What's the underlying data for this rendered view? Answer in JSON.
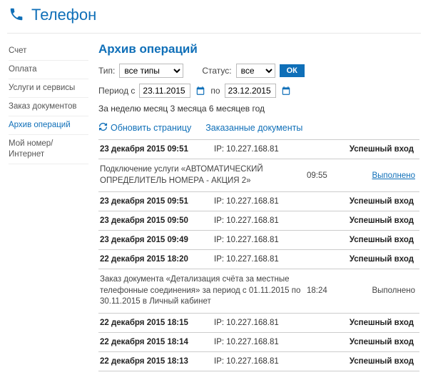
{
  "page": {
    "title": "Телефон"
  },
  "sidebar": {
    "items": [
      {
        "label": "Счет"
      },
      {
        "label": "Оплата"
      },
      {
        "label": "Услуги и сервисы"
      },
      {
        "label": "Заказ документов"
      },
      {
        "label": "Архив операций"
      },
      {
        "label": "Мой номер/Интернет"
      }
    ]
  },
  "main": {
    "heading": "Архив операций",
    "filters": {
      "type_label": "Тип:",
      "type_value": "все типы",
      "status_label": "Статус:",
      "status_value": "все",
      "ok": "ОК",
      "period_label_from": "Период с",
      "period_from": "23.11.2015",
      "period_label_to": "по",
      "period_to": "23.12.2015",
      "quick": {
        "prefix": "За",
        "week": "неделю",
        "month": "месяц",
        "three": "3 месяца",
        "six": "6 месяцев",
        "year": "год"
      }
    },
    "actions": {
      "refresh": "Обновить страницу",
      "ordered_docs": "Заказанные документы"
    },
    "status_text": {
      "success_login": "Успешный вход",
      "done": "Выполнено"
    },
    "ops": [
      {
        "kind": "row",
        "date": "23 декабря 2015 09:51",
        "ip": "IP: 10.227.168.81",
        "status": "success_login"
      },
      {
        "kind": "detail",
        "desc": "Подключение услуги «АВТОМАТИЧЕСКИЙ ОПРЕДЕЛИТЕЛЬ НОМЕРА - АКЦИЯ 2»",
        "time": "09:55",
        "status": "done",
        "link": true
      },
      {
        "kind": "row",
        "date": "23 декабря 2015 09:51",
        "ip": "IP: 10.227.168.81",
        "status": "success_login"
      },
      {
        "kind": "row",
        "date": "23 декабря 2015 09:50",
        "ip": "IP: 10.227.168.81",
        "status": "success_login"
      },
      {
        "kind": "row",
        "date": "23 декабря 2015 09:49",
        "ip": "IP: 10.227.168.81",
        "status": "success_login"
      },
      {
        "kind": "row",
        "date": "22 декабря 2015 18:20",
        "ip": "IP: 10.227.168.81",
        "status": "success_login"
      },
      {
        "kind": "detail",
        "desc": "Заказ документа «Детализация счёта за местные телефонные соединения» за период с 01.11.2015 по 30.11.2015 в Личный кабинет",
        "time": "18:24",
        "status": "done",
        "link": false
      },
      {
        "kind": "row",
        "date": "22 декабря 2015 18:15",
        "ip": "IP: 10.227.168.81",
        "status": "success_login"
      },
      {
        "kind": "row",
        "date": "22 декабря 2015 18:14",
        "ip": "IP: 10.227.168.81",
        "status": "success_login"
      },
      {
        "kind": "row",
        "date": "22 декабря 2015 18:13",
        "ip": "IP: 10.227.168.81",
        "status": "success_login"
      }
    ]
  }
}
